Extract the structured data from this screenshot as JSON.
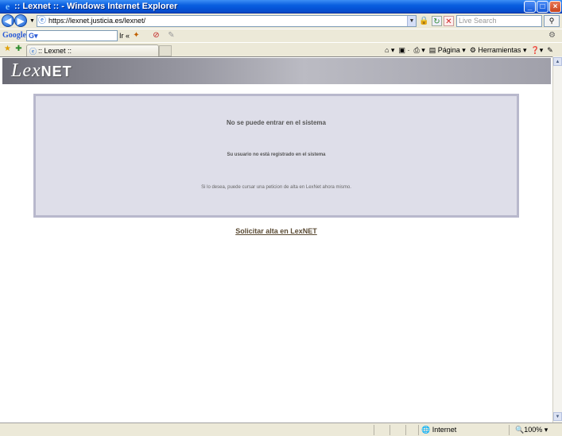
{
  "window": {
    "title": ":: Lexnet :: - Windows Internet Explorer",
    "minimize": "_",
    "maximize": "□",
    "close": "×"
  },
  "address_bar": {
    "url": "https://lexnet.justicia.es/lexnet/",
    "search_placeholder": "Live Search"
  },
  "google_toolbar": {
    "logo": "Google",
    "search_prefix": "G▾",
    "go_label": "Ir"
  },
  "tabs": [
    {
      "label": ":: Lexnet ::"
    }
  ],
  "command_bar": {
    "page_label": "Página",
    "tools_label": "Herramientas"
  },
  "page": {
    "banner_logo_a": "Lex",
    "banner_logo_b": "NET",
    "message_title": "No se puede entrar en el sistema",
    "message_sub": "Su usuario no está registrado en el sistema",
    "message_body": "Si lo desea, puede cursar una peticion de alta en LexNet ahora mismo.",
    "action_link": "Solicitar alta en LexNET"
  },
  "status_bar": {
    "zone": "Internet",
    "zoom": "100%"
  },
  "colors": {
    "titlebar": "#0453d6",
    "message_box_bg": "#dedee9",
    "message_box_border": "#b8b8cc",
    "link": "#5a4a33"
  }
}
